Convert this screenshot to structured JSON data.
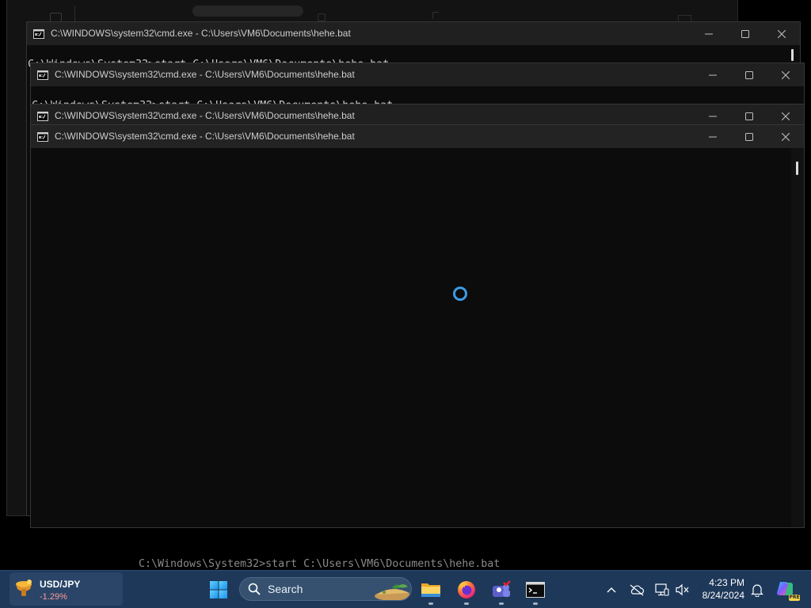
{
  "background_console": {
    "line": "C:\\Windows\\System32>start C:\\Users\\VM6\\Documents\\hehe.bat"
  },
  "windows": [
    {
      "title": "C:\\WINDOWS\\system32\\cmd.exe - C:\\Users\\VM6\\Documents\\hehe.bat",
      "icon": "cmd-icon",
      "console_line": "C:\\Windows\\System32>start C:\\Users\\VM6\\Documents\\hehe.bat"
    },
    {
      "title": "C:\\WINDOWS\\system32\\cmd.exe - C:\\Users\\VM6\\Documents\\hehe.bat",
      "icon": "cmd-icon",
      "console_line": "C:\\Windows\\System32>start C:\\Users\\VM6\\Documents\\hehe.bat"
    },
    {
      "title": "C:\\WINDOWS\\system32\\cmd.exe - C:\\Users\\VM6\\Documents\\hehe.bat",
      "icon": "cmd-icon"
    },
    {
      "title": "C:\\WINDOWS\\system32\\cmd.exe - C:\\Users\\VM6\\Documents\\hehe.bat",
      "icon": "cmd-icon",
      "loading_icon": "loading-spinner-icon"
    }
  ],
  "title_bar_controls": [
    "minimize-icon",
    "maximize-icon",
    "close-icon"
  ],
  "taskbar": {
    "widget": {
      "icon": "currency-widget-icon",
      "label": "USD/JPY",
      "change": "-1.29%"
    },
    "start_icon": "windows-start-icon",
    "search": {
      "icon": "search-icon",
      "label": "Search",
      "highlight_icon": "search-highlight-illustration"
    },
    "pinned_apps": [
      "file-explorer-icon",
      "firefox-icon",
      "chat-app-icon",
      "cmd-icon"
    ],
    "tray": {
      "icons": [
        "chevron-up-icon",
        "onedrive-offline-icon",
        "network-icon",
        "volume-muted-icon"
      ],
      "clock": {
        "time": "4:23 PM",
        "date": "8/24/2024"
      },
      "notification_icon": "bell-icon",
      "copilot": {
        "icon": "copilot-icon",
        "badge": "PRE"
      }
    }
  },
  "colors": {
    "taskbar": "#1e3859",
    "console_background": "#0c0c0c",
    "title_bar": "#202020",
    "spinner": "#3b9ce6",
    "negative_change": "#ff9a9a"
  }
}
